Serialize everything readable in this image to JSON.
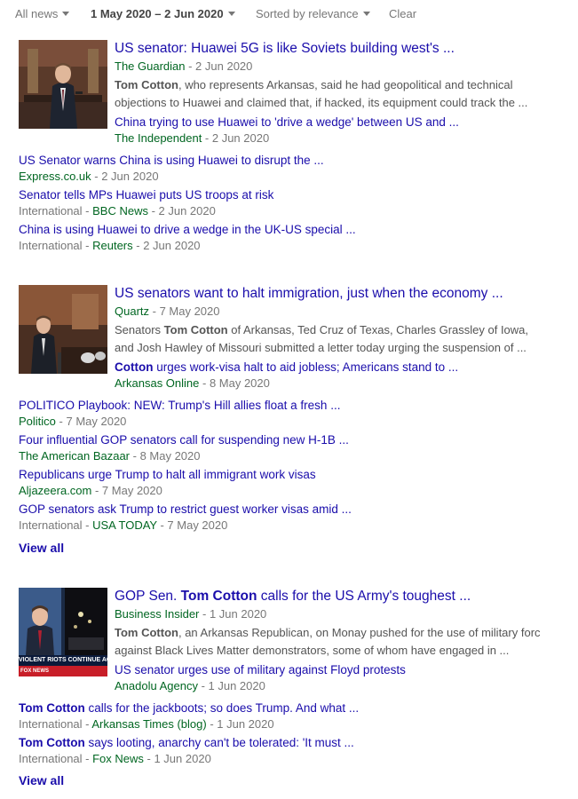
{
  "toolbar": {
    "all_news": "All news",
    "date_range": "1 May 2020 – 2 Jun 2020",
    "sort": "Sorted by relevance",
    "clear": "Clear"
  },
  "clusters": [
    {
      "title": "US senator: Huawei 5G is like Soviets building west's ...",
      "source": "The Guardian",
      "date": " - 2 Jun 2020",
      "snippet_bold": "Tom Cotton",
      "snippet_line1": ", who represents Arkansas, said he had geopolitical and technical",
      "snippet_line2": "objections to Huawei and claimed that, if hacked, its equipment could track the ...",
      "sub": {
        "title": "China trying to use Huawei to 'drive a wedge' between US and ...",
        "source": "The Independent",
        "date": " - 2 Jun 2020"
      },
      "list": [
        {
          "title": "US Senator warns China is using Huawei to disrupt the ...",
          "prefix": "",
          "source": "Express.co.uk",
          "date": " - 2 Jun 2020"
        },
        {
          "title": "Senator tells MPs Huawei puts US troops at risk",
          "prefix": "International - ",
          "source": "BBC News",
          "date": " - 2 Jun 2020"
        },
        {
          "title": "China is using Huawei to drive a wedge in the UK-US special ...",
          "prefix": "International - ",
          "source": "Reuters",
          "date": " - 2 Jun 2020"
        }
      ]
    },
    {
      "title": "US senators want to halt immigration, just when the economy ...",
      "source": "Quartz",
      "date": " - 7 May 2020",
      "snippet_pre": "Senators ",
      "snippet_bold": "Tom Cotton",
      "snippet_line1": " of Arkansas, Ted Cruz of Texas, Charles Grassley of Iowa,",
      "snippet_line2": "and Josh Hawley of Missouri submitted a letter today urging the suspension of ...",
      "sub": {
        "title_bold": "Cotton",
        "title": " urges work-visa halt to aid jobless; Americans stand to ...",
        "source": "Arkansas Online",
        "date": " - 8 May 2020"
      },
      "list": [
        {
          "title": "POLITICO Playbook: NEW: Trump's Hill allies float a fresh ...",
          "prefix": "",
          "source": "Politico",
          "date": " - 7 May 2020"
        },
        {
          "title": "Four influential GOP senators call for suspending new H-1B ...",
          "prefix": "",
          "source": "The American Bazaar",
          "date": " - 8 May 2020"
        },
        {
          "title": "Republicans urge Trump to halt all immigrant work visas",
          "prefix": "",
          "source": "Aljazeera.com",
          "date": " - 7 May 2020"
        },
        {
          "title": "GOP senators ask Trump to restrict guest worker visas amid ...",
          "prefix": "International - ",
          "source": "USA TODAY",
          "date": " - 7 May 2020"
        }
      ],
      "view_all": "View all"
    },
    {
      "title_pre": "GOP Sen. ",
      "title_bold": "Tom Cotton",
      "title": " calls for the US Army's toughest ...",
      "source": "Business Insider",
      "date": " - 1 Jun 2020",
      "snippet_bold": "Tom Cotton",
      "snippet_line1": ", an Arkansas Republican, on Monay pushed for the use of military force",
      "snippet_line2": "against Black Lives Matter demonstrators, some of whom have engaged in ...",
      "thumb_text": "VIOLENT RIOTS CONTINUE AC",
      "thumb_logo": "FOX NEWS",
      "sub": {
        "title": "US senator urges use of military against Floyd protests",
        "source": "Anadolu Agency",
        "date": " - 1 Jun 2020"
      },
      "list": [
        {
          "title_bold": "Tom Cotton",
          "title": " calls for the jackboots; so does Trump. And what ...",
          "prefix": "International - ",
          "source": "Arkansas Times (blog)",
          "date": " - 1 Jun 2020"
        },
        {
          "title_bold": "Tom Cotton",
          "title": " says looting, anarchy can't be tolerated: 'It must ...",
          "prefix": "International - ",
          "source": "Fox News",
          "date": " - 1 Jun 2020"
        }
      ],
      "view_all": "View all"
    }
  ],
  "colors": {
    "link": "#1a0dab",
    "source": "#006621",
    "meta": "#777777"
  }
}
